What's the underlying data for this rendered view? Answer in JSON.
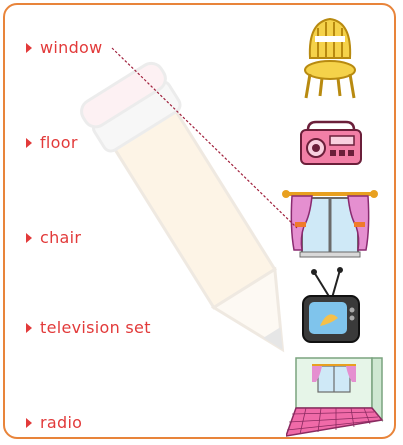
{
  "words": [
    {
      "label": "window"
    },
    {
      "label": "floor"
    },
    {
      "label": "chair"
    },
    {
      "label": "television set"
    },
    {
      "label": "radio"
    }
  ],
  "pictures": [
    {
      "icon": "chair-icon"
    },
    {
      "icon": "radio-icon"
    },
    {
      "icon": "window-icon"
    },
    {
      "icon": "television-icon"
    },
    {
      "icon": "room-floor-icon"
    }
  ],
  "matched_line": {
    "from": "window",
    "to": "window-icon"
  },
  "colors": {
    "border": "#e8843a",
    "text": "#e23a3a",
    "line": "#a0203c"
  }
}
